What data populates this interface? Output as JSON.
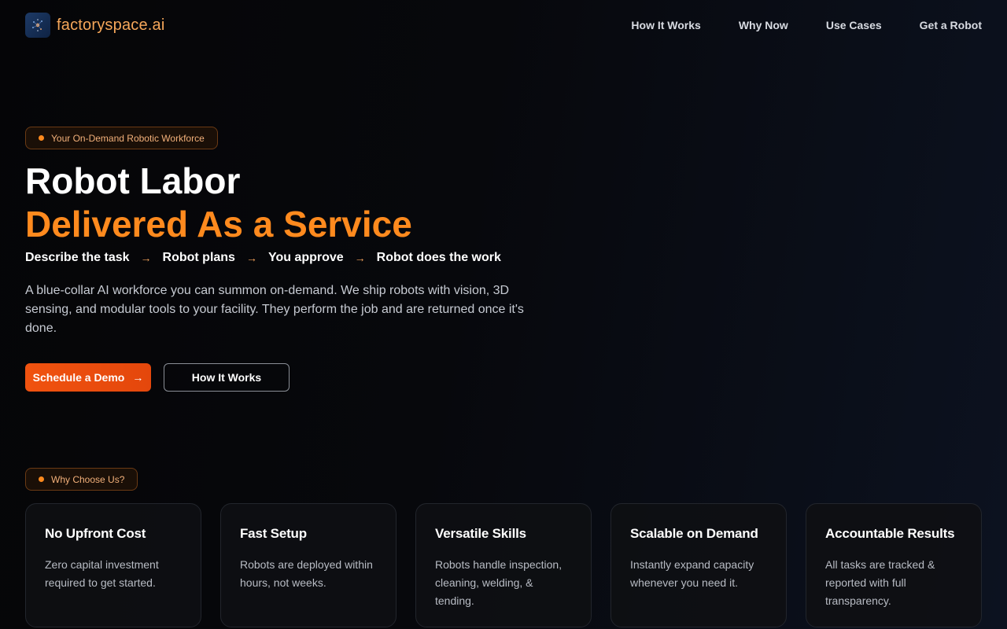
{
  "brand": {
    "name": "factoryspace.ai",
    "logo_icon": "robot-logo-icon"
  },
  "nav": {
    "items": [
      {
        "label": "How It Works"
      },
      {
        "label": "Why Now"
      },
      {
        "label": "Use Cases"
      },
      {
        "label": "Get a Robot"
      }
    ]
  },
  "hero": {
    "badge": "Your On-Demand Robotic Workforce",
    "title_line1": "Robot Labor",
    "title_line2": "Delivered As a Service",
    "steps": [
      "Describe the task",
      "Robot plans",
      "You approve",
      "Robot does the work"
    ],
    "description": "A blue-collar AI workforce you can summon on-demand. We ship robots with vision, 3D sensing, and modular tools to your facility. They perform the job and are returned once it's done.",
    "primary_button": "Schedule a Demo",
    "secondary_button": "How It Works"
  },
  "why": {
    "badge": "Why Choose Us?",
    "cards": [
      {
        "title": "No Upfront Cost",
        "text": "Zero capital investment required to get started."
      },
      {
        "title": "Fast Setup",
        "text": "Robots are deployed within hours, not weeks."
      },
      {
        "title": "Versatile Skills",
        "text": "Robots handle inspection, cleaning, welding, & tending."
      },
      {
        "title": "Scalable on Demand",
        "text": "Instantly expand capacity whenever you need it."
      },
      {
        "title": "Accountable Results",
        "text": "All tasks are tracked & reported with full transparency."
      }
    ]
  },
  "colors": {
    "accent": "#ff8a1e",
    "button": "#f0520f",
    "brand_text": "#f6a75a"
  }
}
